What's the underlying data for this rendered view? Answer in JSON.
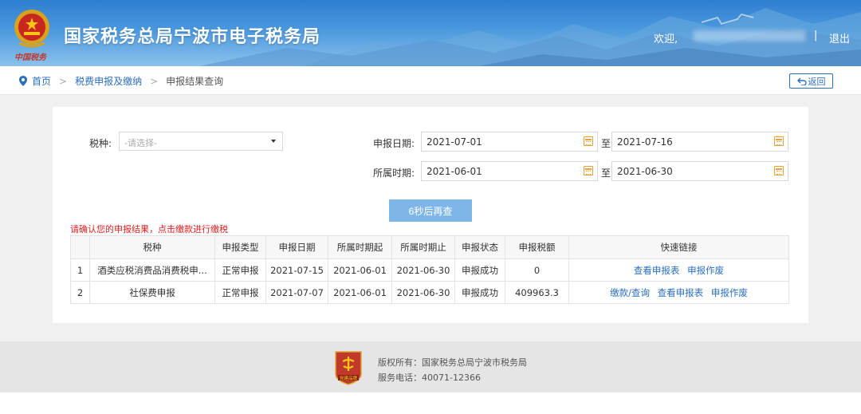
{
  "header": {
    "title": "国家税务总局宁波市电子税务局",
    "emblem_text": "中国税务",
    "welcome": "欢迎,",
    "separator": "|",
    "logout": "退出"
  },
  "breadcrumb": {
    "home": "首页",
    "arrow": ">",
    "section": "税费申报及缴纳",
    "current": "申报结果查询",
    "back": "返回"
  },
  "form": {
    "tax_type_label": "税种:",
    "tax_type_placeholder": "-请选择-",
    "declare_date_label": "申报日期:",
    "declare_date_from": "2021-07-01",
    "declare_date_to": "2021-07-16",
    "period_label": "所属时期:",
    "period_from": "2021-06-01",
    "period_to": "2021-06-30",
    "to_label": "至",
    "query_button": "6秒后再查"
  },
  "notice": "请确认您的申报结果，点击缴款进行缴税",
  "table": {
    "headers": [
      "",
      "税种",
      "申报类型",
      "申报日期",
      "所属时期起",
      "所属时期止",
      "申报状态",
      "申报税额",
      "快速链接"
    ],
    "rows": [
      {
        "index": "1",
        "tax": "酒类应税消费品消费税申...",
        "type": "正常申报",
        "date": "2021-07-15",
        "period_start": "2021-06-01",
        "period_end": "2021-06-30",
        "status": "申报成功",
        "amount": "0",
        "links": [
          "查看申报表",
          "申报作废"
        ]
      },
      {
        "index": "2",
        "tax": "社保费申报",
        "type": "正常申报",
        "date": "2021-07-07",
        "period_start": "2021-06-01",
        "period_end": "2021-06-30",
        "status": "申报成功",
        "amount": "409963.3",
        "links": [
          "缴款/查询",
          "查看申报表",
          "申报作废"
        ]
      }
    ]
  },
  "footer": {
    "copyright": "版权所有：国家税务总局宁波市税务局",
    "phone": "服务电话：40071-12366",
    "badge_text": "党建品牌"
  }
}
